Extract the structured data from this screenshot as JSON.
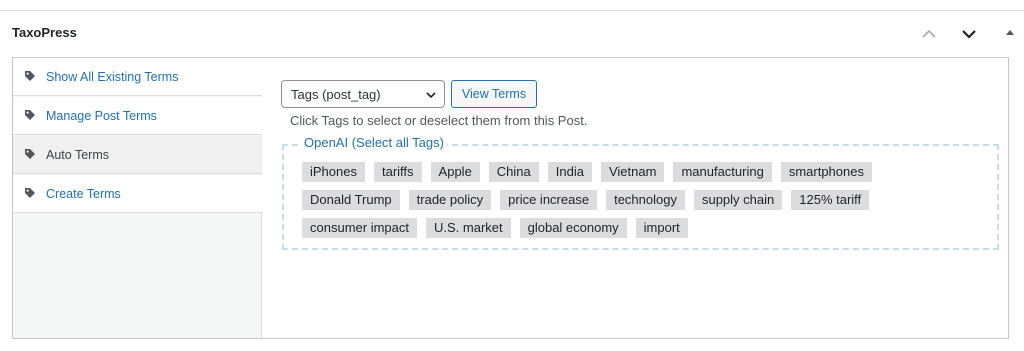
{
  "panel": {
    "title": "TaxoPress",
    "move_up_icon": "chevron-up-icon",
    "move_down_icon": "chevron-down-icon",
    "toggle_icon": "triangle-up-icon"
  },
  "sidebar": {
    "items": [
      {
        "label": "Show All Existing Terms",
        "icon": "tag-icon",
        "active": false
      },
      {
        "label": "Manage Post Terms",
        "icon": "tag-icon",
        "active": false
      },
      {
        "label": "Auto Terms",
        "icon": "tag-icon",
        "active": true
      },
      {
        "label": "Create Terms",
        "icon": "tag-icon",
        "active": false
      }
    ]
  },
  "main": {
    "taxonomy_select": {
      "selected": "Tags (post_tag)"
    },
    "view_button": "View Terms",
    "hint": "Click Tags to select or deselect them from this Post.",
    "suggestion_group": {
      "legend": "OpenAI (Select all Tags)",
      "rows": [
        [
          "iPhones",
          "tariffs",
          "Apple",
          "China",
          "India",
          "Vietnam",
          "manufacturing",
          "smartphones"
        ],
        [
          "Donald Trump",
          "trade policy",
          "price increase",
          "technology",
          "supply chain",
          "125% tariff"
        ],
        [
          "consumer impact",
          "U.S. market",
          "global economy",
          "import"
        ]
      ]
    }
  },
  "colors": {
    "link": "#2271b1",
    "tag_bg": "#dcdcde",
    "dashed_border": "#c5dde8"
  }
}
